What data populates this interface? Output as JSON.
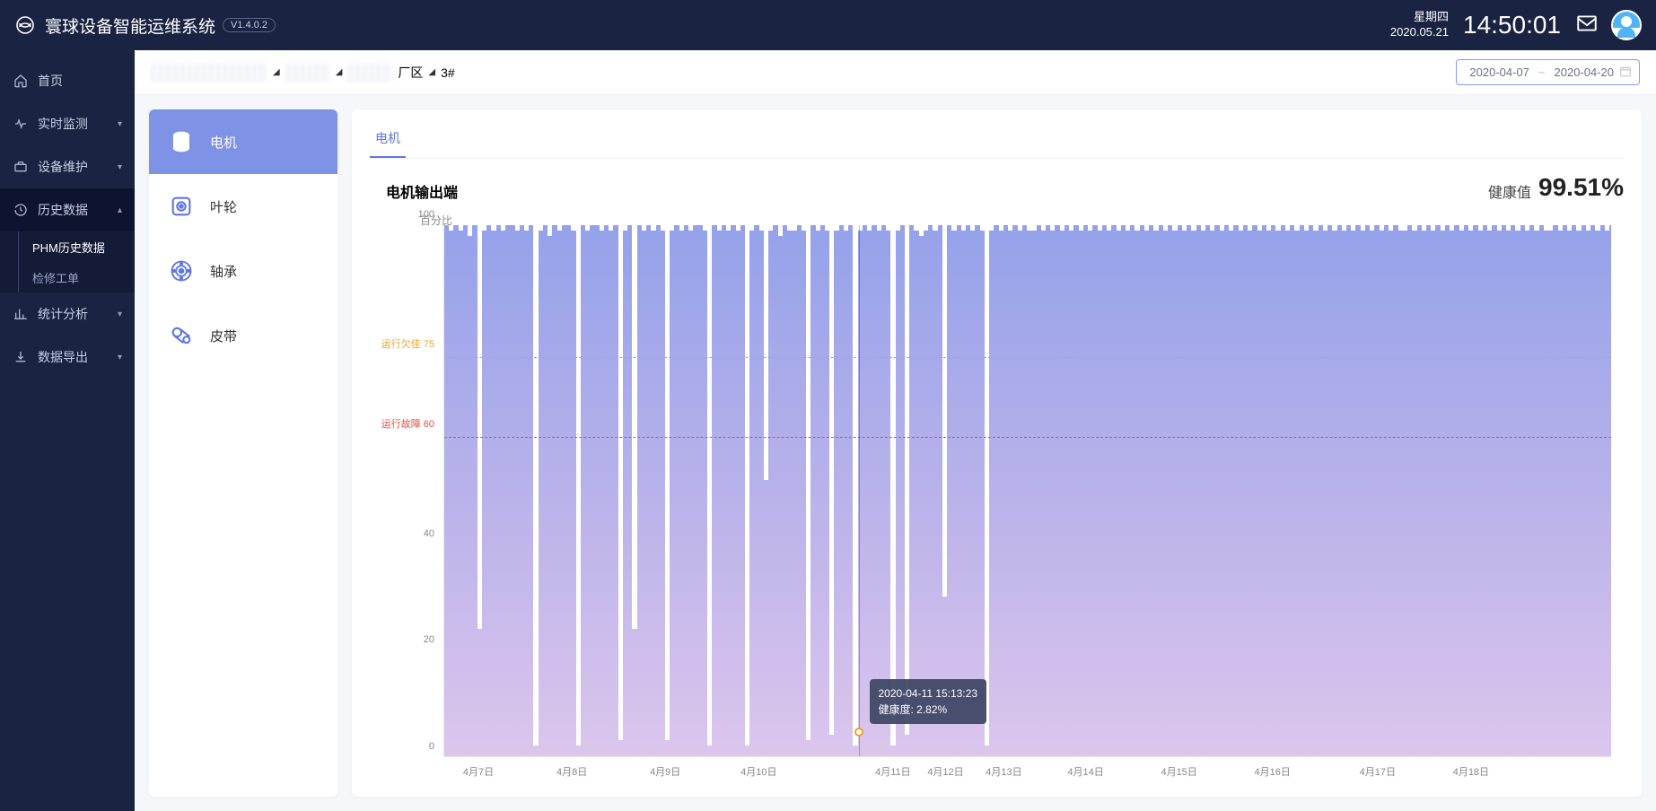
{
  "header": {
    "app_title": "寰球设备智能运维系统",
    "version": "V1.4.0.2",
    "weekday": "星期四",
    "date": "2020.05.21",
    "time": "14:50:01"
  },
  "sidebar": {
    "items": [
      {
        "label": "首页",
        "icon": "home"
      },
      {
        "label": "实时监测",
        "icon": "monitor",
        "caret": true
      },
      {
        "label": "设备维护",
        "icon": "maintain",
        "caret": true
      },
      {
        "label": "历史数据",
        "icon": "history",
        "caret": true,
        "active": true,
        "children": [
          {
            "label": "PHM历史数据",
            "active": true
          },
          {
            "label": "检修工单"
          }
        ]
      },
      {
        "label": "统计分析",
        "icon": "analytics",
        "caret": true
      },
      {
        "label": "数据导出",
        "icon": "export",
        "caret": true
      }
    ]
  },
  "breadcrumb": {
    "seg3_suffix": "厂区",
    "seg4": "3#"
  },
  "date_range": {
    "start": "2020-04-07",
    "sep": "~",
    "end": "2020-04-20"
  },
  "components": [
    {
      "label": "电机",
      "icon": "motor",
      "active": true
    },
    {
      "label": "叶轮",
      "icon": "impeller"
    },
    {
      "label": "轴承",
      "icon": "bearing"
    },
    {
      "label": "皮带",
      "icon": "belt"
    }
  ],
  "tabs": [
    {
      "label": "电机",
      "active": true
    }
  ],
  "chart": {
    "title": "电机输出端",
    "health_label": "健康值",
    "health_value": "99.51%",
    "y_title": "百分比",
    "mark_warn_label": "运行欠佳 75",
    "mark_err_label": "运行故障 60"
  },
  "tooltip": {
    "time": "2020-04-11 15:13:23",
    "value": "健康度: 2.82%"
  },
  "chart_data": {
    "type": "area",
    "ylabel": "百分比",
    "ylim": [
      0,
      100
    ],
    "yticks": [
      0,
      20,
      40,
      100
    ],
    "mark_lines": [
      {
        "label": "运行欠佳",
        "value": 75,
        "color": "#f0a020"
      },
      {
        "label": "运行故障",
        "value": 60,
        "color": "#e74c3c"
      }
    ],
    "x_categories": [
      "4月7日",
      "4月8日",
      "4月9日",
      "4月10日",
      "4月11日",
      "4月12日",
      "4月13日",
      "4月14日",
      "4月15日",
      "4月16日",
      "4月17日",
      "4月18日"
    ],
    "hover_point": {
      "time": "2020-04-11 15:13:23",
      "value": 2.82
    },
    "series": [
      {
        "name": "健康度",
        "values": [
          100,
          99,
          100,
          99,
          100,
          98,
          100,
          24,
          99,
          100,
          99,
          100,
          99,
          100,
          100,
          99,
          100,
          99,
          100,
          2,
          99,
          100,
          98,
          100,
          99,
          100,
          100,
          99,
          2,
          100,
          99,
          100,
          100,
          99,
          100,
          99,
          100,
          3,
          99,
          100,
          24,
          100,
          99,
          100,
          99,
          100,
          99,
          3,
          99,
          100,
          99,
          100,
          99,
          100,
          100,
          99,
          2,
          100,
          99,
          100,
          99,
          100,
          99,
          100,
          2,
          99,
          100,
          99,
          52,
          99,
          100,
          98,
          100,
          99,
          99,
          100,
          99,
          3,
          100,
          99,
          100,
          99,
          4,
          99,
          100,
          99,
          100,
          2,
          99,
          100,
          99,
          100,
          99,
          100,
          99,
          2,
          99,
          100,
          4,
          100,
          99,
          98,
          99,
          100,
          99,
          100,
          30,
          100,
          99,
          100,
          99,
          100,
          99,
          100,
          99,
          2,
          99,
          100,
          99,
          100,
          99,
          100,
          99,
          100,
          99,
          99,
          100,
          99,
          100,
          99,
          100,
          99,
          100,
          99,
          100,
          99,
          100,
          99,
          100,
          99,
          100,
          99,
          100,
          99,
          100,
          99,
          100,
          99,
          100,
          99,
          100,
          99,
          100,
          99,
          100,
          99,
          100,
          99,
          100,
          99,
          100,
          99,
          100,
          99,
          100,
          99,
          100,
          99,
          100,
          99,
          100,
          99,
          100,
          99,
          100,
          99,
          100,
          99,
          100,
          99,
          100,
          99,
          100,
          99,
          100,
          99,
          100,
          99,
          100,
          99,
          100,
          99,
          100,
          99,
          100,
          99,
          100,
          99,
          100,
          99,
          100,
          99,
          100,
          99,
          99,
          100,
          99,
          100,
          99,
          100,
          99,
          100,
          99,
          100,
          99,
          100,
          99,
          100,
          99,
          100,
          99,
          100,
          99,
          100,
          99,
          100,
          99,
          100,
          99,
          100,
          99,
          100,
          99,
          100,
          99,
          99,
          100,
          99,
          100,
          99,
          100,
          99,
          100,
          99,
          100,
          99,
          100,
          99
        ]
      }
    ]
  }
}
